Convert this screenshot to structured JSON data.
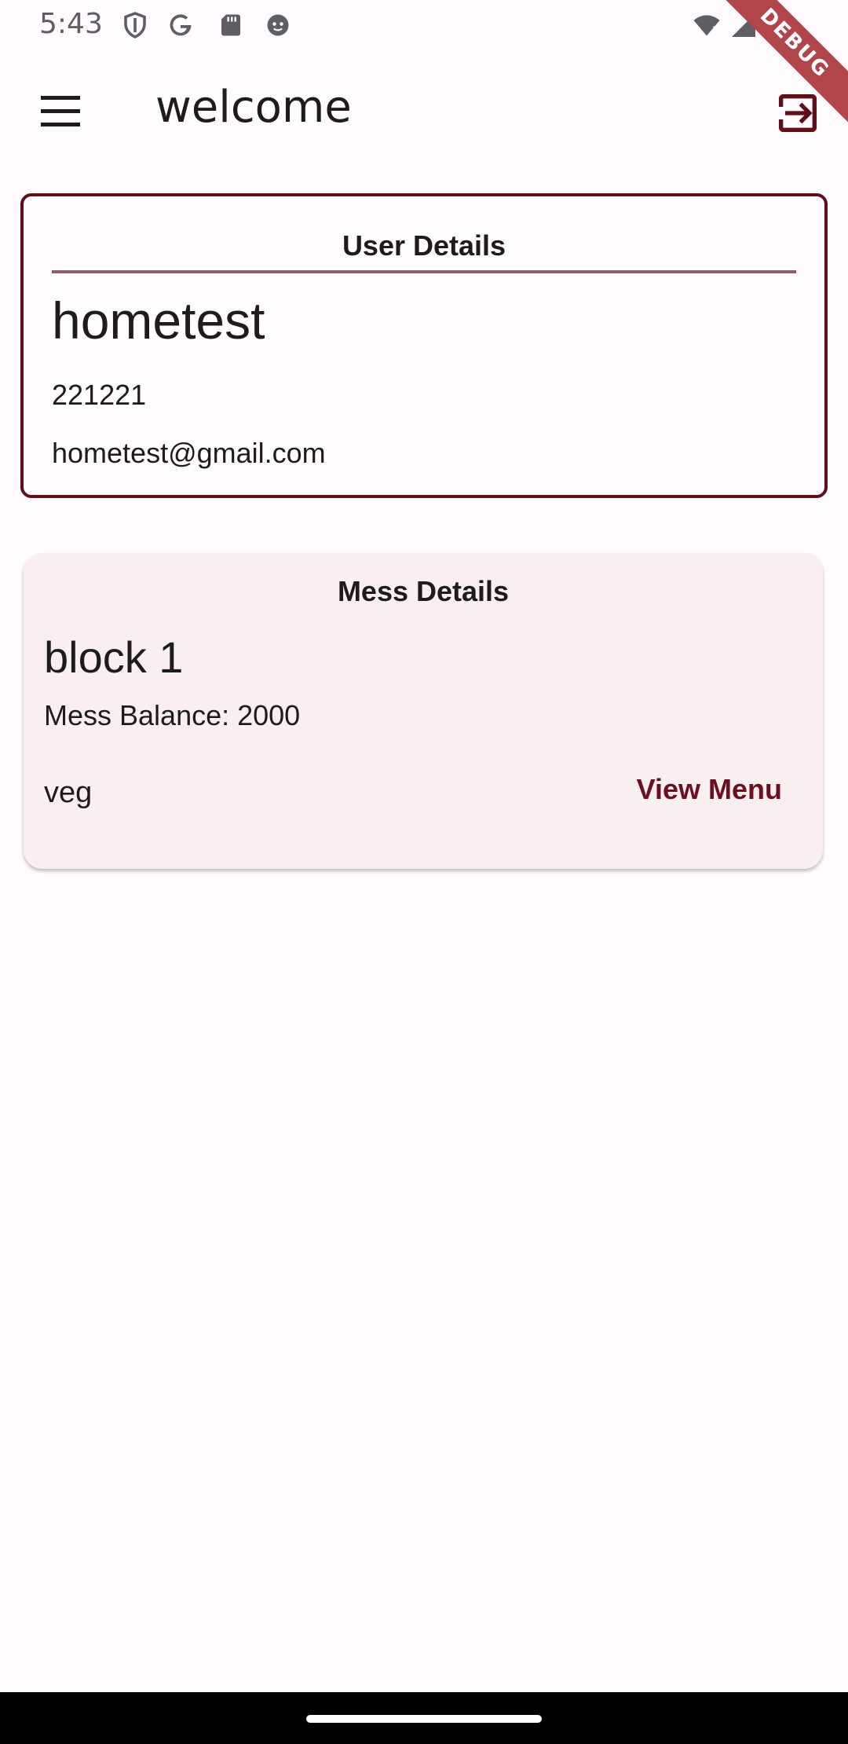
{
  "status_bar": {
    "time": "5:43",
    "left_icons": [
      "shield-icon",
      "google-icon",
      "sd-card-icon",
      "face-icon"
    ],
    "right_icons": [
      "wifi-icon",
      "signal-icon",
      "battery-icon"
    ]
  },
  "debug_banner": {
    "label": "DEBUG"
  },
  "app_bar": {
    "title": "welcome",
    "left_icon": "menu-icon",
    "right_icon": "logout-icon"
  },
  "user_details": {
    "title": "User Details",
    "name": "hometest",
    "id": "221221",
    "email": "hometest@gmail.com"
  },
  "mess_details": {
    "title": "Mess Details",
    "block": "block 1",
    "balance": "Mess Balance: 2000",
    "food_type": "veg",
    "view_menu_label": "View Menu"
  },
  "colors": {
    "primary": "#5e1019",
    "accent_text": "#6b1020",
    "background": "#fffbfe",
    "card_surface": "#f9eef0",
    "divider": "#8d5d63",
    "debug_ribbon": "#b1454c"
  }
}
